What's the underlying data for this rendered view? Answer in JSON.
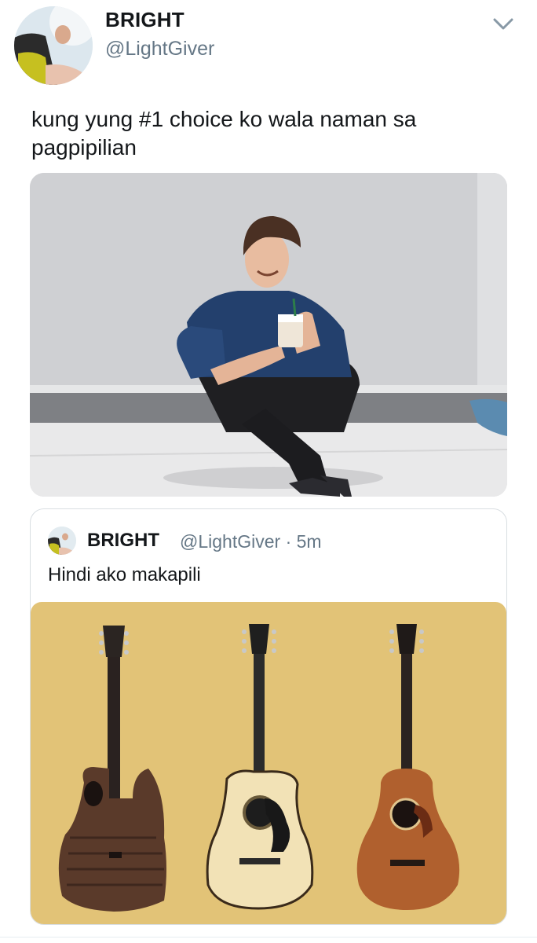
{
  "tweet": {
    "display_name": "BRIGHT",
    "handle": "@LightGiver",
    "text": "kung yung #1 choice ko wala naman sa pagpipilian",
    "menu_icon": "chevron-down-icon"
  },
  "quoted_tweet": {
    "display_name": "BRIGHT",
    "meta": "@LightGiver · 5m",
    "text": "Hindi ako makapili"
  },
  "colors": {
    "secondary_text": "#657786",
    "quote_border": "#d9dee2",
    "guitar_bg": "#e2c377"
  }
}
